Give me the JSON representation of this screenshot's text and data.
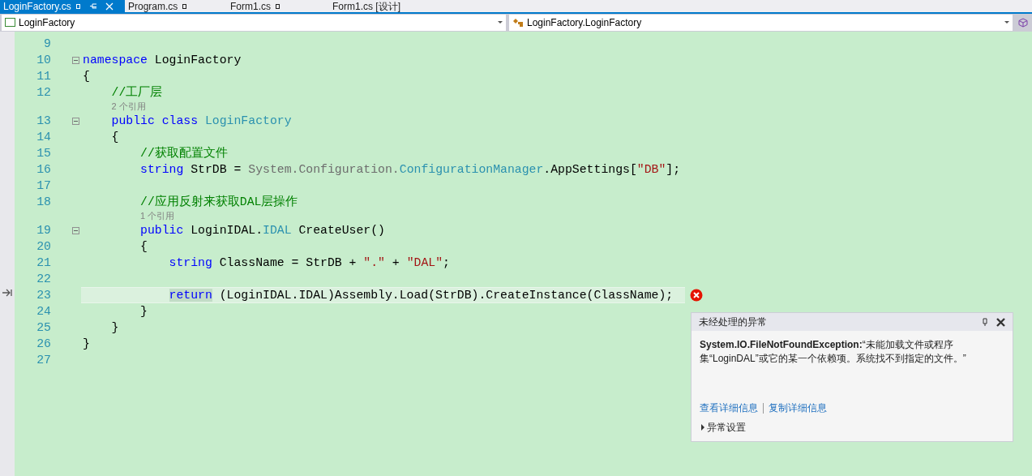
{
  "tabs": [
    {
      "label": "LoginFactory.cs",
      "locked": true,
      "selected": true
    },
    {
      "label": "Program.cs",
      "locked": true,
      "selected": false
    },
    {
      "label": "Form1.cs",
      "locked": true,
      "selected": false
    },
    {
      "label": "Form1.cs [设计]",
      "locked": false,
      "selected": false
    }
  ],
  "nav": {
    "type_dropdown": "LoginFactory",
    "member_dropdown": "LoginFactory.LoginFactory"
  },
  "lines": [
    {
      "number": "9",
      "fold": false,
      "current": false,
      "error": false
    },
    {
      "number": "10",
      "fold": true,
      "current": false,
      "error": false,
      "tokens": [
        {
          "kind": "kw",
          "text": "namespace"
        },
        {
          "kind": "plain",
          "text": " LoginFactory"
        }
      ]
    },
    {
      "number": "11",
      "fold": false,
      "current": false,
      "error": false,
      "tokens": [
        {
          "kind": "plain",
          "text": "{"
        }
      ]
    },
    {
      "number": "12",
      "fold": false,
      "current": false,
      "error": false,
      "tokens": [
        {
          "kind": "comment",
          "text": "    //工厂层"
        }
      ]
    },
    {
      "number": "13",
      "fold": true,
      "current": false,
      "error": false,
      "codelens": "2 个引用",
      "tokens": [
        {
          "kind": "kw",
          "text": "    public class "
        },
        {
          "kind": "type",
          "text": "LoginFactory"
        }
      ]
    },
    {
      "number": "14",
      "fold": false,
      "current": false,
      "error": false,
      "tokens": [
        {
          "kind": "plain",
          "text": "    {"
        }
      ]
    },
    {
      "number": "15",
      "fold": false,
      "current": false,
      "error": false,
      "tokens": [
        {
          "kind": "comment",
          "text": "        //获取配置文件"
        }
      ]
    },
    {
      "number": "16",
      "fold": false,
      "current": false,
      "error": false,
      "tokens": [
        {
          "kind": "kw",
          "text": "        string"
        },
        {
          "kind": "plain",
          "text": " StrDB = "
        },
        {
          "kind": "dim",
          "text": "System.Configuration."
        },
        {
          "kind": "type",
          "text": "ConfigurationManager"
        },
        {
          "kind": "plain",
          "text": ".AppSettings["
        },
        {
          "kind": "str",
          "text": "\"DB\""
        },
        {
          "kind": "plain",
          "text": "];"
        }
      ]
    },
    {
      "number": "17",
      "fold": false,
      "current": false,
      "error": false
    },
    {
      "number": "18",
      "fold": false,
      "current": false,
      "error": false,
      "tokens": [
        {
          "kind": "comment",
          "text": "        //应用反射来获取DAL层操作"
        }
      ]
    },
    {
      "number": "19",
      "fold": true,
      "current": false,
      "error": false,
      "codelens": "1 个引用",
      "tokens": [
        {
          "kind": "kw",
          "text": "        public"
        },
        {
          "kind": "plain",
          "text": " LoginIDAL."
        },
        {
          "kind": "type",
          "text": "IDAL"
        },
        {
          "kind": "plain",
          "text": " CreateUser()"
        }
      ]
    },
    {
      "number": "20",
      "fold": false,
      "current": false,
      "error": false,
      "tokens": [
        {
          "kind": "plain",
          "text": "        {"
        }
      ]
    },
    {
      "number": "21",
      "fold": false,
      "current": false,
      "error": false,
      "tokens": [
        {
          "kind": "kw",
          "text": "            string"
        },
        {
          "kind": "plain",
          "text": " ClassName = StrDB + "
        },
        {
          "kind": "str",
          "text": "\".\""
        },
        {
          "kind": "plain",
          "text": " + "
        },
        {
          "kind": "str",
          "text": "\"DAL\""
        },
        {
          "kind": "plain",
          "text": ";"
        }
      ]
    },
    {
      "number": "22",
      "fold": false,
      "current": false,
      "error": false
    },
    {
      "number": "23",
      "fold": false,
      "current": true,
      "error": true,
      "tokens": [
        {
          "kind": "kw",
          "text": "            return"
        },
        {
          "kind": "plain",
          "text": " (LoginIDAL.IDAL)Assembly.Load(StrDB).CreateInstance(ClassName);"
        }
      ]
    },
    {
      "number": "24",
      "fold": false,
      "current": false,
      "error": false,
      "tokens": [
        {
          "kind": "plain",
          "text": "        }"
        }
      ]
    },
    {
      "number": "25",
      "fold": false,
      "current": false,
      "error": false,
      "tokens": [
        {
          "kind": "plain",
          "text": "    }"
        }
      ]
    },
    {
      "number": "26",
      "fold": false,
      "current": false,
      "error": false,
      "tokens": [
        {
          "kind": "plain",
          "text": "}"
        }
      ]
    },
    {
      "number": "27",
      "fold": false,
      "current": false,
      "error": false
    }
  ],
  "exception": {
    "title": "未经处理的异常",
    "message": "**System.IO.FileNotFoundException:**“未能加载文件或程序集“LoginDAL”或它的某一个依赖项。系统找不到指定的文件。”",
    "links": [
      "查看详细信息",
      "复制详细信息"
    ],
    "settings": "异常设置"
  }
}
